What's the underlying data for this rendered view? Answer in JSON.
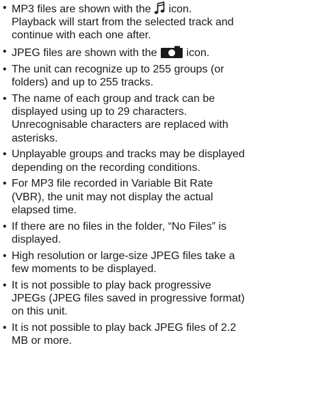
{
  "bullet": "•",
  "icons": {
    "music_note": "music-note-icon",
    "camera": "camera-icon",
    "color": "#1a1a1a"
  },
  "notes": [
    {
      "lines": [
        {
          "before": "MP3 files are shown with the ",
          "after": " icon."
        },
        "Playback will start from the selected track and",
        "continue with each one after."
      ]
    },
    {
      "lines": [
        {
          "before": "JPEG files are shown with the ",
          "after": " icon."
        }
      ]
    },
    {
      "lines": [
        "The unit can recognize up to 255 groups (or",
        "folders) and up to 255 tracks."
      ]
    },
    {
      "lines": [
        "The name of each group and track can be",
        "displayed using up to 29 characters.",
        "Unrecognisable characters are replaced with",
        "asterisks."
      ]
    },
    {
      "lines": [
        "Unplayable groups and tracks may be displayed",
        "depending on the recording conditions."
      ]
    },
    {
      "lines": [
        "For MP3 file recorded in Variable Bit Rate",
        "(VBR), the unit may not display the actual",
        "elapsed time."
      ]
    },
    {
      "lines": [
        "If there are no files in the folder, “No Files” is",
        "displayed."
      ]
    },
    {
      "lines": [
        "High resolution or large-size JPEG files take a",
        "few moments to be displayed."
      ]
    },
    {
      "lines": [
        "It is not possible to play back progressive",
        "JPEGs (JPEG files saved in progressive format)",
        "on this unit."
      ]
    },
    {
      "lines": [
        "It is not possible to play back JPEG files of 2.2",
        "MB or more."
      ]
    }
  ]
}
